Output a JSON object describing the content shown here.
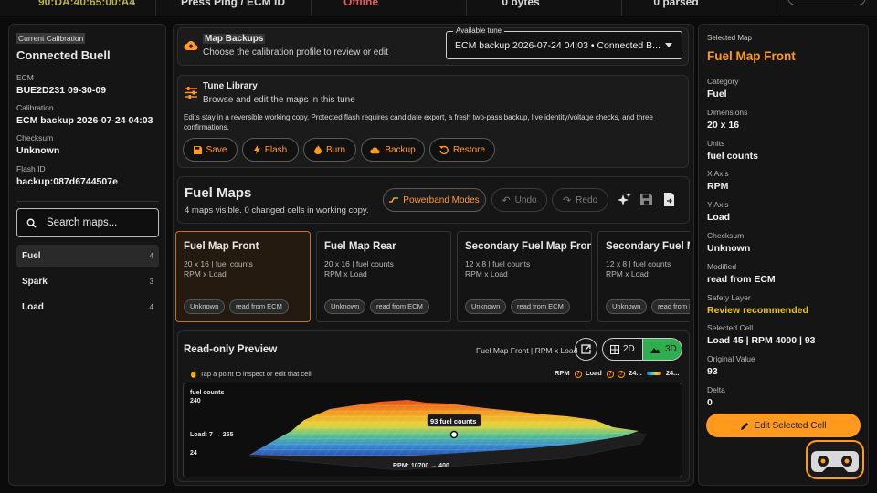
{
  "topbar": {
    "mac": "90:DA:40:65:00:A4",
    "ping_label": "Press Ping / ECM ID",
    "status": "Offline",
    "bytes": "0 bytes",
    "parsed": "0 parsed"
  },
  "left": {
    "section_title": "Current Calibration",
    "bike": "Connected Buell",
    "ecm_label": "ECM",
    "ecm_value": "BUE2D231 09-30-09",
    "calibration_label": "Calibration",
    "calibration_value": "ECM backup 2026-07-24 04:03",
    "checksum_label": "Checksum",
    "checksum_value": "Unknown",
    "flash_label": "Flash ID",
    "flash_value": "backup:087d6744507e",
    "search_placeholder": "Search maps...",
    "categories": [
      {
        "name": "Fuel",
        "count": "4"
      },
      {
        "name": "Spark",
        "count": "3"
      },
      {
        "name": "Load",
        "count": "4"
      }
    ]
  },
  "backups": {
    "title": "Map Backups",
    "subtitle": "Choose the calibration profile to review or edit",
    "select_label": "Available tune",
    "select_value": "ECM backup 2026-07-24 04:03 • Connected B..."
  },
  "library": {
    "title": "Tune Library",
    "subtitle": "Browse and edit the maps in this tune",
    "note": "Edits stay in a reversible working copy. Protected flash requires candidate export, a fresh two-pass backup, live identity/voltage checks, and three confirmations.",
    "buttons": {
      "save": "Save",
      "flash": "Flash",
      "burn": "Burn",
      "backup": "Backup",
      "restore": "Restore"
    }
  },
  "fuel_maps": {
    "title": "Fuel Maps",
    "subtitle": "4 maps visible. 0 changed cells in working copy.",
    "powerband": "Powerband Modes",
    "undo": "Undo",
    "redo": "Redo",
    "cards": [
      {
        "title": "Fuel Map Front",
        "dims": "20 x 16 | fuel counts",
        "axes": "RPM x Load",
        "chip1": "Unknown",
        "chip2": "read from ECM"
      },
      {
        "title": "Fuel Map Rear",
        "dims": "20 x 16 | fuel counts",
        "axes": "RPM x Load",
        "chip1": "Unknown",
        "chip2": "read from ECM"
      },
      {
        "title": "Secondary Fuel Map Front",
        "dims": "12 x 8 | fuel counts",
        "axes": "RPM x Load",
        "chip1": "Unknown",
        "chip2": "read from ECM"
      },
      {
        "title": "Secondary Fuel Ma",
        "dims": "12 x 8 | fuel counts",
        "axes": "RPM x Load",
        "chip1": "Unknown",
        "chip2": "read from ECM"
      }
    ]
  },
  "preview": {
    "title": "Read-only Preview",
    "context": "Fuel Map Front | RPM x Load",
    "mode_2d": "2D",
    "mode_3d": "3D",
    "hint": "Tap a point to inspect or edit that cell",
    "rpm_label": "RPM",
    "load_label": "Load",
    "range_a": "24...",
    "range_b": "24...",
    "z_label": "fuel counts",
    "z_max": "240",
    "z_min": "24",
    "load_range": "Load: 7 → 255",
    "rpm_range": "RPM: 10700 → 400",
    "tooltip": "93 fuel counts"
  },
  "selected": {
    "header": "Selected Map",
    "name": "Fuel Map Front",
    "fields": [
      {
        "label": "Category",
        "value": "Fuel"
      },
      {
        "label": "Dimensions",
        "value": "20 x 16"
      },
      {
        "label": "Units",
        "value": "fuel counts"
      },
      {
        "label": "X Axis",
        "value": "RPM"
      },
      {
        "label": "Y Axis",
        "value": "Load"
      },
      {
        "label": "Checksum",
        "value": "Unknown"
      },
      {
        "label": "Modified",
        "value": "read from ECM"
      },
      {
        "label": "Safety Layer",
        "value": "Review recommended"
      },
      {
        "label": "Selected Cell",
        "value": "Load 45 | RPM 4000 | 93"
      },
      {
        "label": "Original Value",
        "value": "93"
      },
      {
        "label": "Delta",
        "value": "0"
      }
    ],
    "edit_button": "Edit Selected Cell"
  },
  "colors": {
    "accent": "#ff9a1f",
    "warning": "#f2c40f",
    "success": "#2fae4e"
  }
}
